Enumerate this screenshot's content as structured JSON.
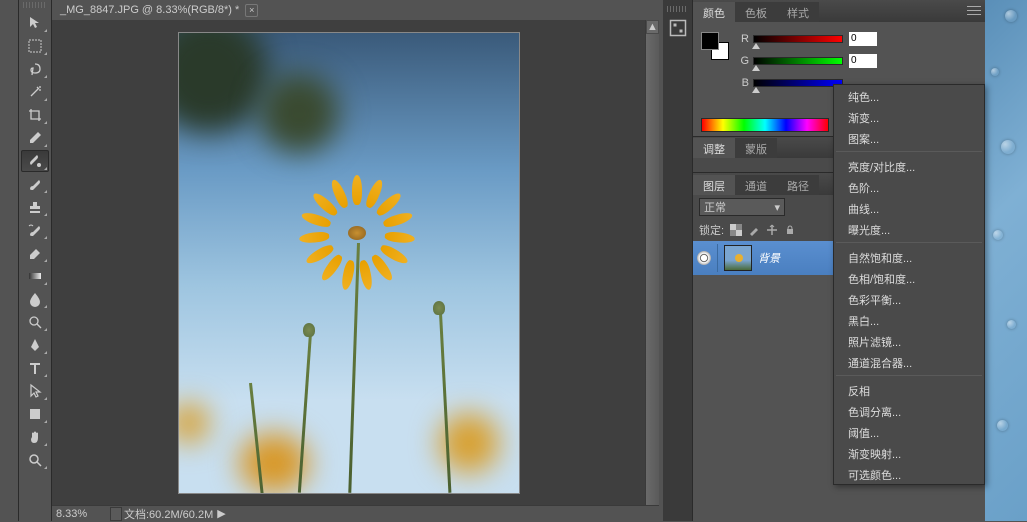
{
  "document": {
    "tab_title": "_MG_8847.JPG @ 8.33%(RGB/8*) *",
    "zoom": "8.33%",
    "doc_info": "文档:60.2M/60.2M"
  },
  "panels": {
    "color": {
      "tabs": [
        "颜色",
        "色板",
        "样式"
      ],
      "active": 0,
      "sliders": [
        {
          "label": "R",
          "value": "0",
          "gradient": "linear-gradient(90deg,#000,#f00)"
        },
        {
          "label": "G",
          "value": "0",
          "gradient": "linear-gradient(90deg,#000,#0f0)"
        },
        {
          "label": "B",
          "value": "",
          "gradient": "linear-gradient(90deg,#000,#00f)"
        }
      ]
    },
    "adjust": {
      "tabs": [
        "调整",
        "蒙版"
      ],
      "active": 0
    },
    "layers": {
      "tabs": [
        "图层",
        "通道",
        "路径"
      ],
      "active": 0,
      "blend_mode": "正常",
      "lock_label": "锁定:",
      "layer_name": "背景"
    }
  },
  "context_menu": {
    "groups": [
      [
        "纯色...",
        "渐变...",
        "图案..."
      ],
      [
        "亮度/对比度...",
        "色阶...",
        "曲线...",
        "曝光度..."
      ],
      [
        "自然饱和度...",
        "色相/饱和度...",
        "色彩平衡...",
        "黑白...",
        "照片滤镜...",
        "通道混合器..."
      ],
      [
        "反相",
        "色调分离...",
        "阈值...",
        "渐变映射...",
        "可选颜色..."
      ]
    ]
  },
  "tools": [
    "move-tool",
    "marquee-tool",
    "lasso-tool",
    "wand-tool",
    "crop-tool",
    "eyedropper-tool",
    "healing-brush-tool",
    "brush-tool",
    "stamp-tool",
    "history-brush-tool",
    "eraser-tool",
    "gradient-tool",
    "blur-tool",
    "dodge-tool",
    "pen-tool",
    "type-tool",
    "path-select-tool",
    "shape-tool",
    "hand-tool",
    "zoom-tool"
  ]
}
